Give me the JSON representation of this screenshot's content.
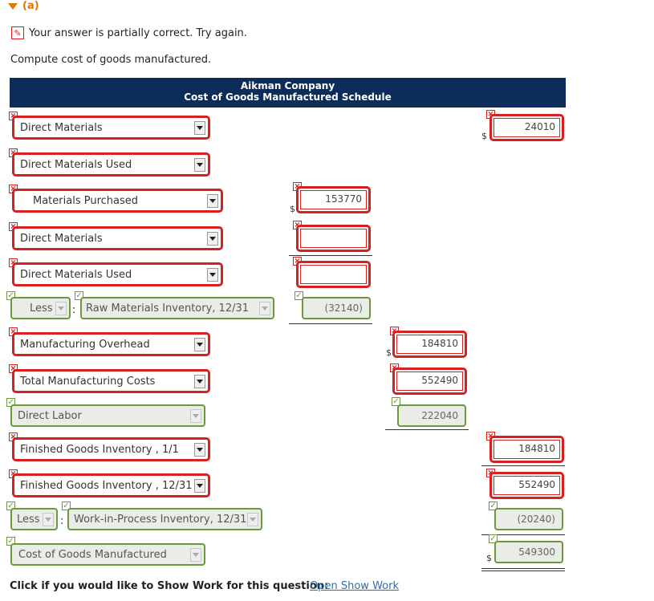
{
  "part": {
    "label": "(a)",
    "icon": "collapse-triangle-icon"
  },
  "status": {
    "icon": "edit-pencil-icon",
    "text": "Your answer is partially correct.  Try again."
  },
  "instruction": "Compute cost of goods manufactured.",
  "schedule": {
    "company": "Aikman Company",
    "title": "Cost of Goods Manufactured Schedule"
  },
  "rows": [
    {
      "label": "Direct Materials",
      "label_status": "incorrect",
      "col3": {
        "value": "24010",
        "status": "incorrect",
        "dollar": true
      }
    },
    {
      "label": "Direct Materials Used",
      "label_status": "incorrect"
    },
    {
      "label": "Materials Purchased",
      "label_status": "incorrect",
      "col1": {
        "value": "153770",
        "status": "incorrect",
        "dollar": true
      }
    },
    {
      "label": "Direct Materials",
      "label_status": "incorrect",
      "col1": {
        "value": "",
        "status": "incorrect"
      }
    },
    {
      "label": "Direct Materials Used",
      "label_status": "incorrect",
      "col1": {
        "value": "",
        "status": "incorrect"
      }
    },
    {
      "prefix": "Less",
      "label": "Raw Materials Inventory, 12/31",
      "label_status": "correct",
      "col1": {
        "value": "(32140)",
        "status": "correct"
      }
    },
    {
      "label": "Manufacturing Overhead",
      "label_status": "incorrect",
      "col2": {
        "value": "184810",
        "status": "incorrect",
        "dollar": true
      }
    },
    {
      "label": "Total Manufacturing Costs",
      "label_status": "incorrect",
      "col2": {
        "value": "552490",
        "status": "incorrect"
      }
    },
    {
      "label": "Direct Labor",
      "label_status": "correct",
      "col2": {
        "value": "222040",
        "status": "correct"
      }
    },
    {
      "label": "Finished Goods Inventory , 1/1",
      "label_status": "incorrect",
      "col3": {
        "value": "184810",
        "status": "incorrect"
      }
    },
    {
      "label": "Finished Goods Inventory , 12/31",
      "label_status": "incorrect",
      "col3": {
        "value": "552490",
        "status": "incorrect"
      }
    },
    {
      "prefix": "Less",
      "label": "Work-in-Process Inventory, 12/31",
      "label_status": "correct",
      "col3": {
        "value": "(20240)",
        "status": "correct"
      }
    },
    {
      "label": "Cost of Goods Manufactured",
      "label_status": "correct",
      "col3": {
        "value": "549300",
        "status": "correct",
        "dollar": true
      }
    }
  ],
  "marks": {
    "incorrect": "×",
    "correct": "✓"
  },
  "currency_symbol": "$",
  "colon": ":",
  "footer": {
    "prompt": "Click if you would like to Show Work for this question:",
    "link": "Open Show Work"
  },
  "colors": {
    "banner": "#0c2d5a",
    "incorrect": "#d82020",
    "correct": "#6a9a3a",
    "accent": "#e07800",
    "link": "#2a6fb3"
  }
}
